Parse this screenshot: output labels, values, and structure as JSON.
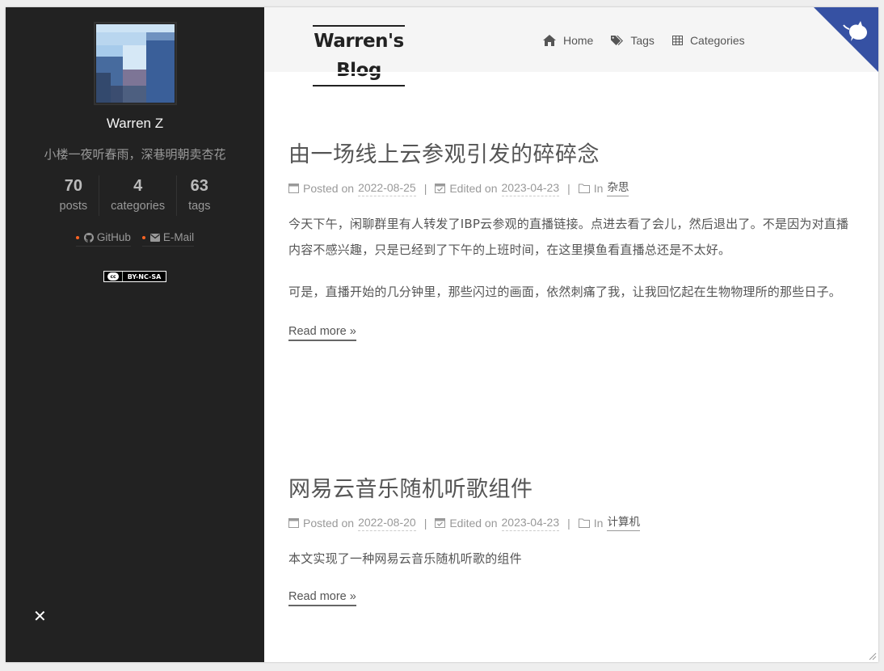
{
  "sidebar": {
    "author_name": "Warren Z",
    "description": "小楼一夜听春雨，深巷明朝卖杏花",
    "stats": [
      {
        "count": "70",
        "label": "posts"
      },
      {
        "count": "4",
        "label": "categories"
      },
      {
        "count": "63",
        "label": "tags"
      }
    ],
    "links": [
      {
        "label": "GitHub",
        "icon": "github-icon"
      },
      {
        "label": "E-Mail",
        "icon": "envelope-icon"
      }
    ],
    "license": {
      "left": "cc",
      "right": "BY-NC-SA"
    },
    "close_symbol": "✕"
  },
  "header": {
    "site_title": "Warren's Blog",
    "menu": [
      {
        "label": "Home",
        "icon": "home-icon"
      },
      {
        "label": "Tags",
        "icon": "tags-icon"
      },
      {
        "label": "Categories",
        "icon": "th-icon"
      }
    ]
  },
  "posts": [
    {
      "title": "由一场线上云参观引发的碎碎念",
      "posted_label": "Posted on",
      "posted_date": "2022-08-25",
      "edited_label": "Edited on",
      "edited_date": "2023-04-23",
      "in_label": "In",
      "category": "杂思",
      "paragraphs": [
        "今天下午，闲聊群里有人转发了IBP云参观的直播链接。点进去看了会儿，然后退出了。不是因为对直播内容不感兴趣，只是已经到了下午的上班时间，在这里摸鱼看直播总还是不太好。",
        "可是，直播开始的几分钟里，那些闪过的画面，依然刺痛了我，让我回忆起在生物物理所的那些日子。"
      ],
      "read_more": "Read more »"
    },
    {
      "title": "网易云音乐随机听歌组件",
      "posted_label": "Posted on",
      "posted_date": "2022-08-20",
      "edited_label": "Edited on",
      "edited_date": "2023-04-23",
      "in_label": "In",
      "category": "计算机",
      "paragraphs": [
        "本文实现了一种网易云音乐随机听歌的组件"
      ],
      "read_more": "Read more »"
    }
  ],
  "colors": {
    "sidebar_bg": "#222222",
    "header_bg": "#f5f5f5",
    "corner_blue": "#3651a3",
    "link_dot": "#fc6423"
  }
}
